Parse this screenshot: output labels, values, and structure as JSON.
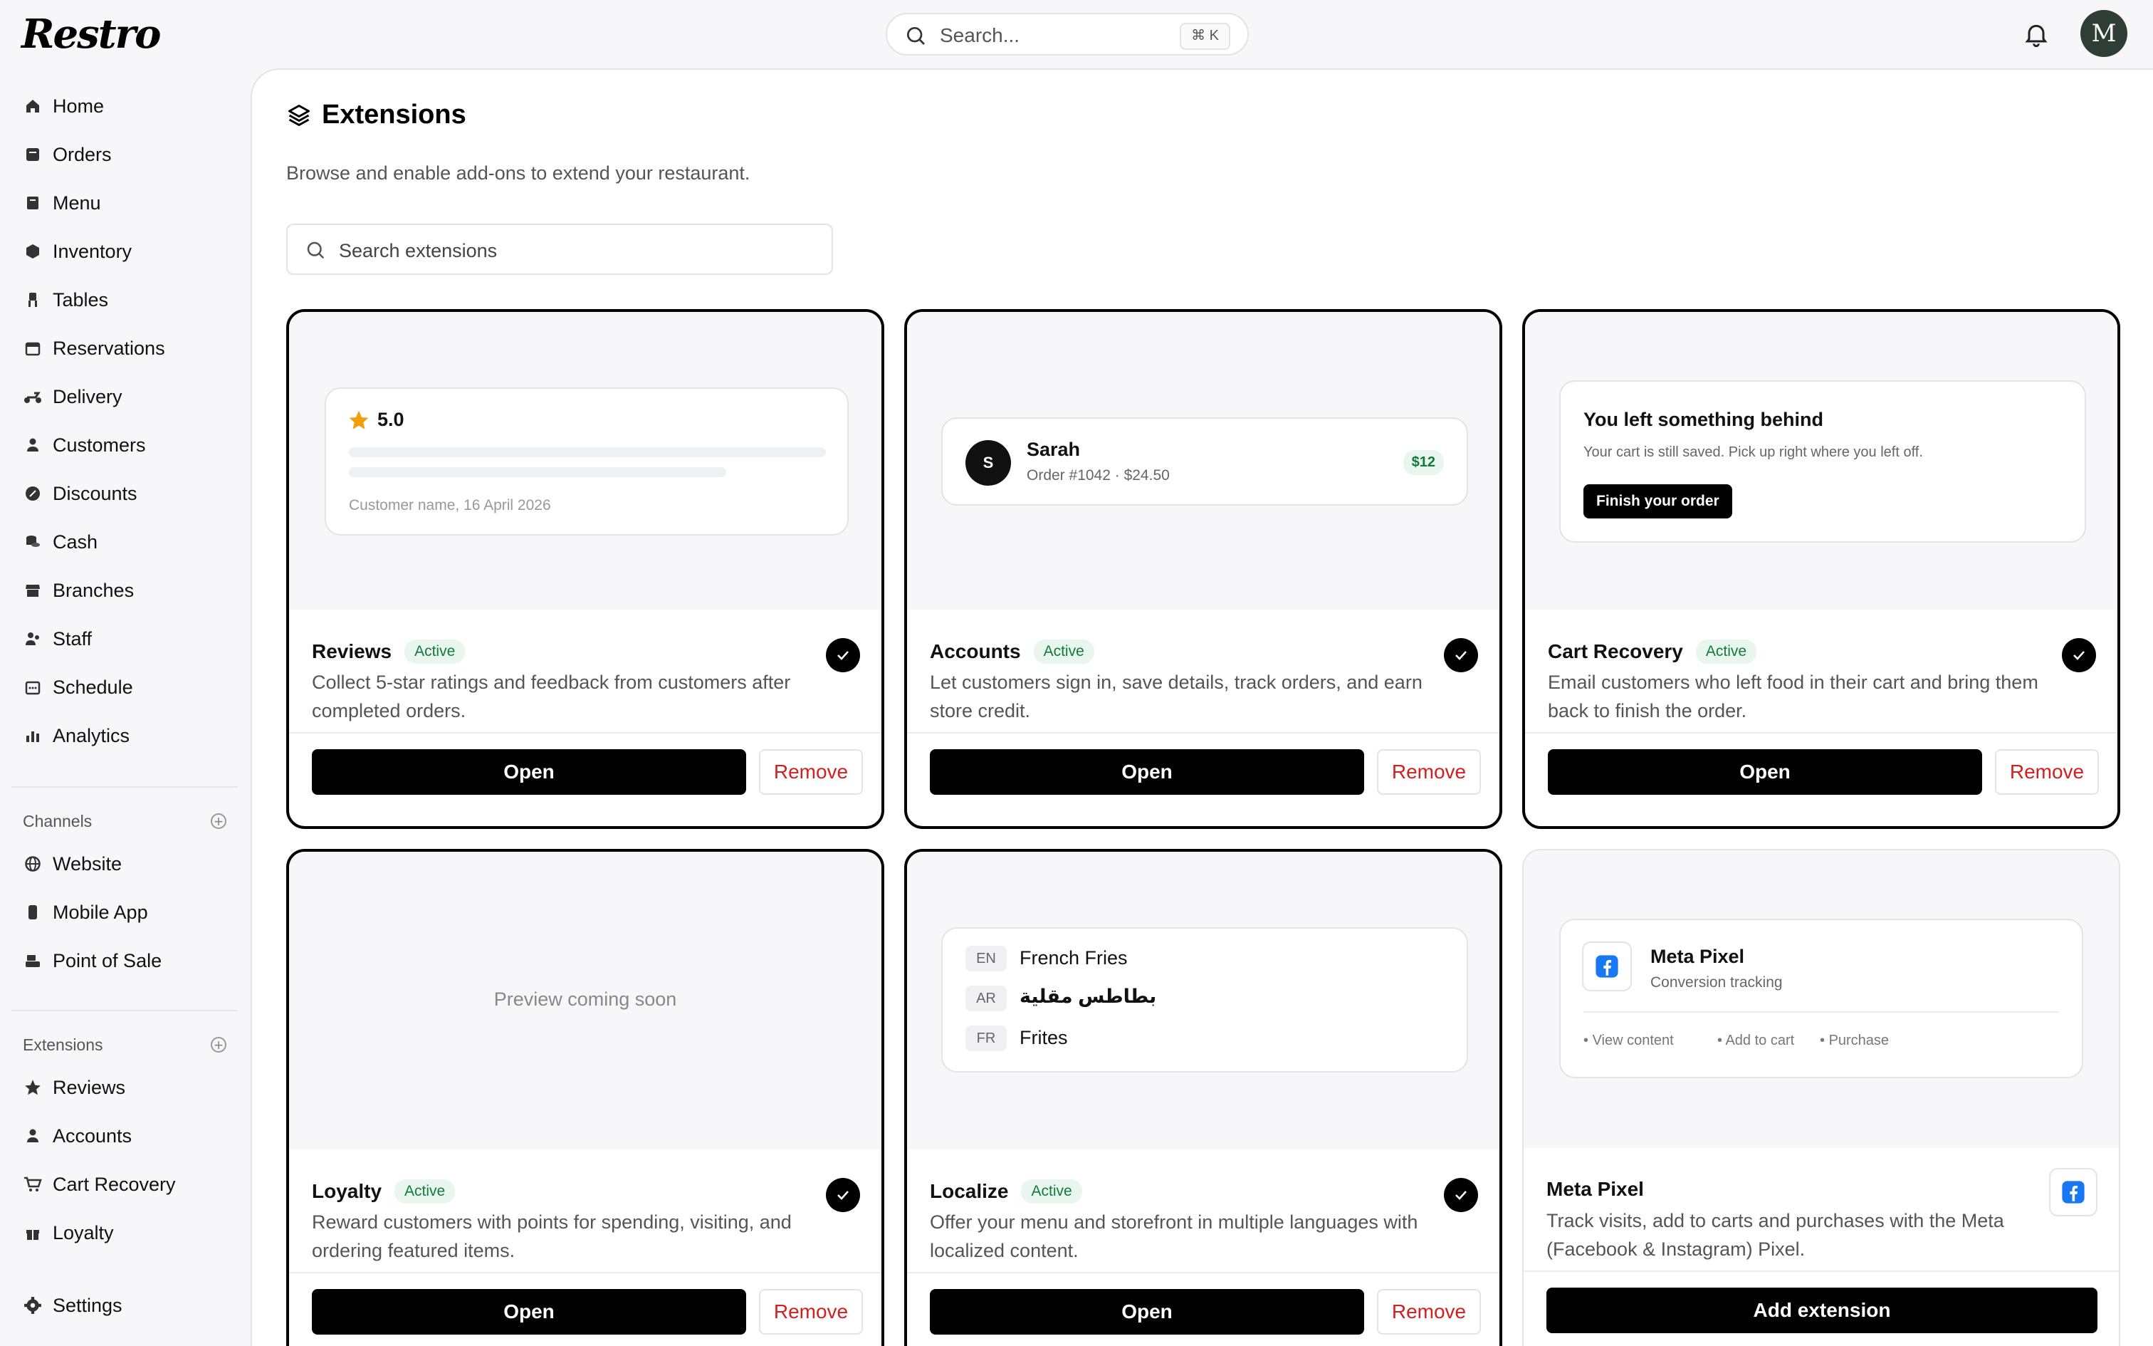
{
  "app": {
    "logo_text": "Restro"
  },
  "search": {
    "placeholder": "Search...",
    "shortcut": "⌘ K"
  },
  "user": {
    "avatar_initial": "M"
  },
  "sidebar": {
    "nav": [
      {
        "label": "Home",
        "icon": "home-icon"
      },
      {
        "label": "Orders",
        "icon": "orders-icon"
      },
      {
        "label": "Menu",
        "icon": "menu-book-icon"
      },
      {
        "label": "Inventory",
        "icon": "box-icon"
      },
      {
        "label": "Tables",
        "icon": "chair-icon"
      },
      {
        "label": "Reservations",
        "icon": "calendar-icon"
      },
      {
        "label": "Delivery",
        "icon": "scooter-icon"
      },
      {
        "label": "Customers",
        "icon": "person-icon"
      },
      {
        "label": "Discounts",
        "icon": "discount-icon"
      },
      {
        "label": "Cash",
        "icon": "coins-icon"
      },
      {
        "label": "Branches",
        "icon": "store-icon"
      },
      {
        "label": "Staff",
        "icon": "staff-icon"
      },
      {
        "label": "Schedule",
        "icon": "schedule-icon"
      },
      {
        "label": "Analytics",
        "icon": "analytics-icon"
      }
    ],
    "channels_title": "Channels",
    "channels": [
      {
        "label": "Website",
        "icon": "globe-icon"
      },
      {
        "label": "Mobile App",
        "icon": "phone-icon"
      },
      {
        "label": "Point of Sale",
        "icon": "pos-icon"
      }
    ],
    "extensions_title": "Extensions",
    "extensions": [
      {
        "label": "Reviews",
        "icon": "star-icon"
      },
      {
        "label": "Accounts",
        "icon": "person-icon"
      },
      {
        "label": "Cart Recovery",
        "icon": "cart-icon"
      },
      {
        "label": "Loyalty",
        "icon": "gift-icon"
      }
    ],
    "settings": {
      "label": "Settings",
      "icon": "gear-icon"
    }
  },
  "page": {
    "title": "Extensions",
    "subtitle": "Browse and enable add-ons to extend your restaurant.",
    "search_placeholder": "Search extensions"
  },
  "cards": [
    {
      "name": "Reviews",
      "status": "Active",
      "description": "Collect 5-star ratings and feedback from customers after completed orders.",
      "open_label": "Open",
      "remove_label": "Remove",
      "preview": {
        "rating": "5.0",
        "footer": "Customer name, 16 April 2026"
      }
    },
    {
      "name": "Accounts",
      "status": "Active",
      "description": "Let customers sign in, save details, track orders, and earn store credit.",
      "open_label": "Open",
      "remove_label": "Remove",
      "preview": {
        "initial": "S",
        "customer": "Sarah",
        "order": "Order #1042 · $24.50",
        "credit": "$12"
      }
    },
    {
      "name": "Cart Recovery",
      "status": "Active",
      "description": "Email customers who left food in their cart and bring them back to finish the order.",
      "open_label": "Open",
      "remove_label": "Remove",
      "preview": {
        "heading": "You left something behind",
        "body": "Your cart is still saved. Pick up right where you left off.",
        "cta": "Finish your order"
      }
    },
    {
      "name": "Loyalty",
      "status": "Active",
      "description": "Reward customers with points for spending, visiting, and ordering featured items.",
      "open_label": "Open",
      "remove_label": "Remove",
      "preview": {
        "placeholder": "Preview coming soon"
      }
    },
    {
      "name": "Localize",
      "status": "Active",
      "description": "Offer your menu and storefront in multiple languages with localized content.",
      "open_label": "Open",
      "remove_label": "Remove",
      "preview": {
        "rows": [
          {
            "code": "EN",
            "text": "French Fries"
          },
          {
            "code": "AR",
            "text": "بطاطس مقلية"
          },
          {
            "code": "FR",
            "text": "Frites"
          }
        ]
      }
    },
    {
      "name": "Meta Pixel",
      "status": "",
      "description": "Track visits, add to carts and purchases with the Meta (Facebook & Instagram) Pixel.",
      "add_label": "Add extension",
      "preview": {
        "title": "Meta Pixel",
        "subtitle": "Conversion tracking",
        "events": [
          "View content",
          "Add to cart",
          "Purchase"
        ]
      }
    }
  ],
  "colors": {
    "accent": "#000000",
    "active_badge_bg": "#e8f6ee",
    "active_badge_text": "#137a3c",
    "remove_text": "#d41f1f",
    "facebook_blue": "#1877f2"
  }
}
